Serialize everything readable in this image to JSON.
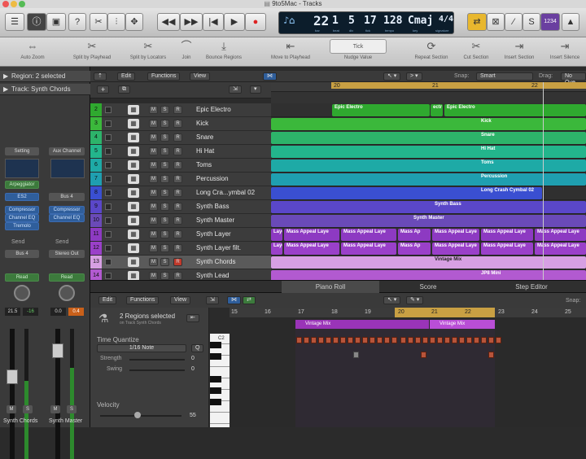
{
  "window": {
    "title": "9to5Mac - Tracks"
  },
  "lcd": {
    "bar": "22",
    "beat": "1",
    "div": "5",
    "tick": "17",
    "tempo": "128",
    "key": "Cmaj",
    "sig": "4/4",
    "labels": {
      "bar": "bar",
      "beat": "beat",
      "div": "div",
      "tick": "tick",
      "tempo": "tempo",
      "key": "key",
      "sig": "signature"
    }
  },
  "countin": "1234",
  "toolbar": {
    "auto_zoom": "Auto Zoom",
    "split_playhead": "Split by Playhead",
    "split_locators": "Split by Locators",
    "join": "Join",
    "bounce": "Bounce Regions",
    "move_playhead": "Move to Playhead",
    "nudge": "Nudge Value",
    "nudge_val": "Tick",
    "repeat": "Repeat Section",
    "cut": "Cut Section",
    "insert": "Insert Section",
    "insert_silence": "Insert Silence"
  },
  "inspector": {
    "region": "Region: 2 selected",
    "track": "Track: Synth Chords",
    "strip1": {
      "setting": "Setting",
      "midi_fx": "Arpeggiator",
      "instrument": "ES2",
      "fx": [
        "Compressor",
        "Channel EQ",
        "Tremolo"
      ],
      "send": "Send",
      "bus": "Bus 4",
      "read": "Read",
      "vol": "21.5",
      "peak": "-16",
      "name": "Synth Chords"
    },
    "strip2": {
      "setting": "Aux Channel",
      "input": "Bus 4",
      "fx": [
        "Compressor",
        "Channel EQ"
      ],
      "send": "Send",
      "bus": "Stereo Out",
      "read": "Read",
      "vol": "0.0",
      "peak": "0.4",
      "name": "Synth Master"
    },
    "m": "M",
    "s": "S"
  },
  "tracks_menu": {
    "edit": "Edit",
    "functions": "Functions",
    "view": "View",
    "snap_label": "Snap:",
    "snap": "Smart",
    "drag_label": "Drag:",
    "drag": "No Ove"
  },
  "ruler": [
    "20",
    "21",
    "22"
  ],
  "buttons": {
    "m": "M",
    "s": "S",
    "r": "R"
  },
  "tracks": [
    {
      "num": "2",
      "name": "Epic Electro",
      "color": "#2fa92f",
      "regions": [
        {
          "label": "Epic Electro"
        },
        {
          "label": "ectr"
        },
        {
          "label": "Epic Electro"
        }
      ]
    },
    {
      "num": "3",
      "name": "Kick",
      "color": "#3bb83b",
      "regions": [
        {
          "label": "Kick"
        }
      ]
    },
    {
      "num": "4",
      "name": "Snare",
      "color": "#2db36a",
      "regions": [
        {
          "label": "Snare"
        }
      ]
    },
    {
      "num": "5",
      "name": "Hi Hat",
      "color": "#23b58c",
      "regions": [
        {
          "label": "Hi Hat"
        }
      ]
    },
    {
      "num": "6",
      "name": "Toms",
      "color": "#1eaaa6",
      "regions": [
        {
          "label": "Toms"
        }
      ]
    },
    {
      "num": "7",
      "name": "Percussion",
      "color": "#1f9fb0",
      "regions": [
        {
          "label": "Percussion"
        }
      ]
    },
    {
      "num": "8",
      "name": "Long Cra...ymbal 02",
      "color": "#3a4fd1",
      "regions": [
        {
          "label": "Long Crash Cymbal 02"
        }
      ]
    },
    {
      "num": "9",
      "name": "Synth Bass",
      "color": "#5a47c9",
      "regions": [
        {
          "label": "Synth Bass"
        }
      ]
    },
    {
      "num": "10",
      "name": "Synth Master",
      "color": "#6a4ab8",
      "regions": [
        {
          "label": "Synth Master"
        }
      ]
    },
    {
      "num": "11",
      "name": "Synth Layer",
      "color": "#8d3ac2",
      "regions": [
        {
          "label": "Laye"
        },
        {
          "label": "Mass Appeal Laye"
        },
        {
          "label": "Mass Appeal Laye"
        },
        {
          "label": "Mass Ap"
        },
        {
          "label": "Mass Appeal Laye"
        },
        {
          "label": "Mass Appeal Laye"
        },
        {
          "label": "Mass Appeal Laye"
        }
      ]
    },
    {
      "num": "12",
      "name": "Synth Layer filt.",
      "color": "#9a40c9",
      "regions": [
        {
          "label": "Laye"
        },
        {
          "label": "Mass Appeal Laye"
        },
        {
          "label": "Mass Appeal Laye"
        },
        {
          "label": "Mass Ap"
        },
        {
          "label": "Mass Appeal Laye"
        },
        {
          "label": "Mass Appeal Laye"
        },
        {
          "label": "Mass Appeal Laye"
        }
      ]
    },
    {
      "num": "13",
      "name": "Synth Chords",
      "color": "#d7a0e3",
      "regions": [
        {
          "label": "Vintage Mix"
        }
      ]
    },
    {
      "num": "14",
      "name": "Synth Lead",
      "color": "#b25ad0",
      "regions": [
        {
          "label": "JP8 Mini"
        }
      ]
    }
  ],
  "piano": {
    "tabs": [
      "Piano Roll",
      "Score",
      "Step Editor"
    ],
    "edit": "Edit",
    "functions": "Functions",
    "view": "View",
    "snap_label": "Snap:",
    "regions_selected": "2 Regions selected",
    "on_track": "on Track Synth Chords",
    "time_quantize": "Time Quantize",
    "note": "1/16 Note",
    "q": "Q",
    "strength": "Strength",
    "strength_val": "0",
    "swing": "Swing",
    "swing_val": "0",
    "velocity": "Velocity",
    "velocity_val": "55",
    "c2": "C2",
    "ruler": [
      "15",
      "16",
      "17",
      "18",
      "19",
      "20",
      "21",
      "22",
      "23",
      "24",
      "25"
    ],
    "regions": [
      {
        "label": "Vintage Mix"
      },
      {
        "label": "Vintage Mix"
      }
    ]
  }
}
